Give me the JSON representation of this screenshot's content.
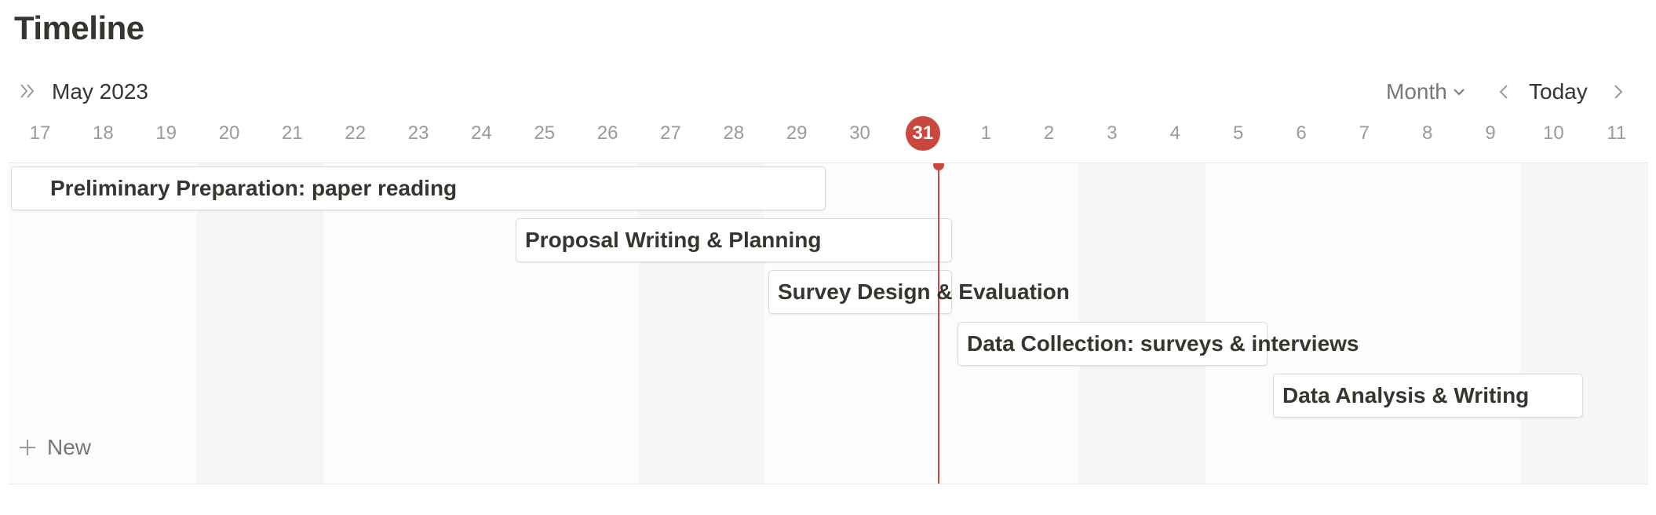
{
  "page": {
    "title": "Timeline"
  },
  "toolbar": {
    "month_label": "May 2023",
    "view_mode": "Month",
    "today_label": "Today",
    "icons": {
      "expand": "double-chevron-right-icon",
      "view_dropdown": "chevron-down-icon",
      "prev": "chevron-left-icon",
      "next": "chevron-right-icon"
    }
  },
  "days": [
    "17",
    "18",
    "19",
    "20",
    "21",
    "22",
    "23",
    "24",
    "25",
    "26",
    "27",
    "28",
    "29",
    "30",
    "31",
    "1",
    "2",
    "3",
    "4",
    "5",
    "6",
    "7",
    "8",
    "9",
    "10",
    "11"
  ],
  "today_day": "31",
  "tasks": [
    {
      "label": "Preliminary Preparation: paper reading"
    },
    {
      "label": "Proposal Writing & Planning"
    },
    {
      "label": "Survey Design & Evaluation"
    },
    {
      "label": "Data Collection: surveys & interviews"
    },
    {
      "label": "Data Analysis & Writing"
    }
  ],
  "new_button": {
    "label": "New",
    "icon": "plus-icon"
  },
  "colors": {
    "today_accent": "#c9473c",
    "text_primary": "#37352f",
    "text_muted": "#9b9a97",
    "weekend_band": "#f6f6f5"
  }
}
